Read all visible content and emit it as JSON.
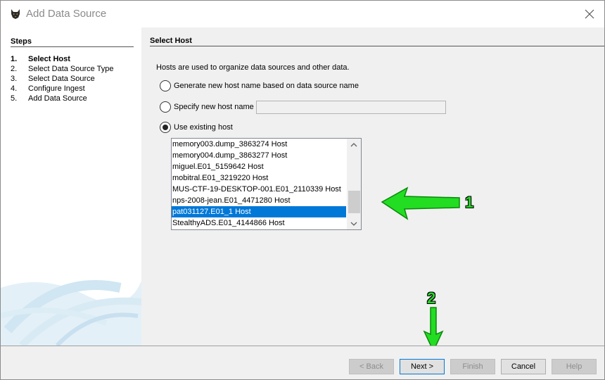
{
  "window": {
    "title": "Add Data Source",
    "app_icon": "autopsy-dog-icon",
    "close_icon": "close-icon"
  },
  "steps": {
    "heading": "Steps",
    "items": [
      {
        "num": "1.",
        "label": "Select Host",
        "current": true
      },
      {
        "num": "2.",
        "label": "Select Data Source Type",
        "current": false
      },
      {
        "num": "3.",
        "label": "Select Data Source",
        "current": false
      },
      {
        "num": "4.",
        "label": "Configure Ingest",
        "current": false
      },
      {
        "num": "5.",
        "label": "Add Data Source",
        "current": false
      }
    ]
  },
  "main": {
    "heading": "Select Host",
    "intro": "Hosts are used to organize data sources and other data.",
    "options": {
      "generate": "Generate new host name based on data source name",
      "specify": "Specify new host name",
      "existing": "Use existing host"
    },
    "selected_option": "existing",
    "new_host_value": "",
    "hosts": [
      "memory003.dump_3863274 Host",
      "memory004.dump_3863277 Host",
      "miguel.E01_5159642 Host",
      "mobitral.E01_3219220 Host",
      "MUS-CTF-19-DESKTOP-001.E01_2110339 Host",
      "nps-2008-jean.E01_4471280 Host",
      "pat031127.E01_1 Host",
      "StealthyADS.E01_4144866 Host"
    ],
    "selected_host": "pat031127.E01_1 Host"
  },
  "annotations": {
    "arrow1_label": "1",
    "arrow2_label": "2",
    "arrow_color": "#22dd22"
  },
  "buttons": {
    "back": "< Back",
    "next": "Next >",
    "finish": "Finish",
    "cancel": "Cancel",
    "help": "Help"
  }
}
